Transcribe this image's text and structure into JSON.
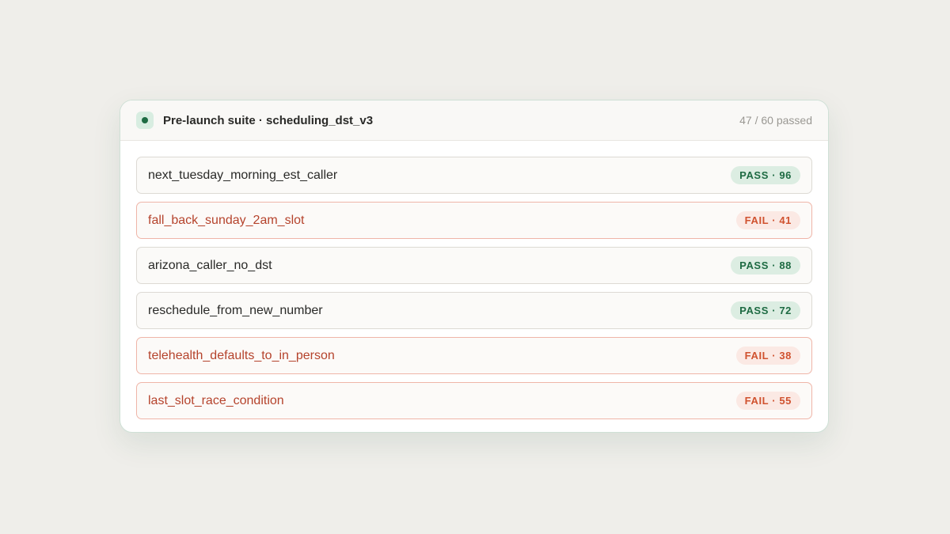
{
  "header": {
    "title": "Pre-launch suite · scheduling_dst_v3",
    "summary": "47 / 60 passed",
    "status_icon": "status-dot-icon"
  },
  "colors": {
    "pass": "#1e6b43",
    "fail": "#d0522f",
    "background": "#efeeea"
  },
  "tests": [
    {
      "name": "next_tuesday_morning_est_caller",
      "status": "pass",
      "badge": "PASS · 96"
    },
    {
      "name": "fall_back_sunday_2am_slot",
      "status": "fail",
      "badge": "FAIL · 41"
    },
    {
      "name": "arizona_caller_no_dst",
      "status": "pass",
      "badge": "PASS · 88"
    },
    {
      "name": "reschedule_from_new_number",
      "status": "pass",
      "badge": "PASS · 72"
    },
    {
      "name": "telehealth_defaults_to_in_person",
      "status": "fail",
      "badge": "FAIL · 38"
    },
    {
      "name": "last_slot_race_condition",
      "status": "fail",
      "badge": "FAIL · 55"
    }
  ]
}
